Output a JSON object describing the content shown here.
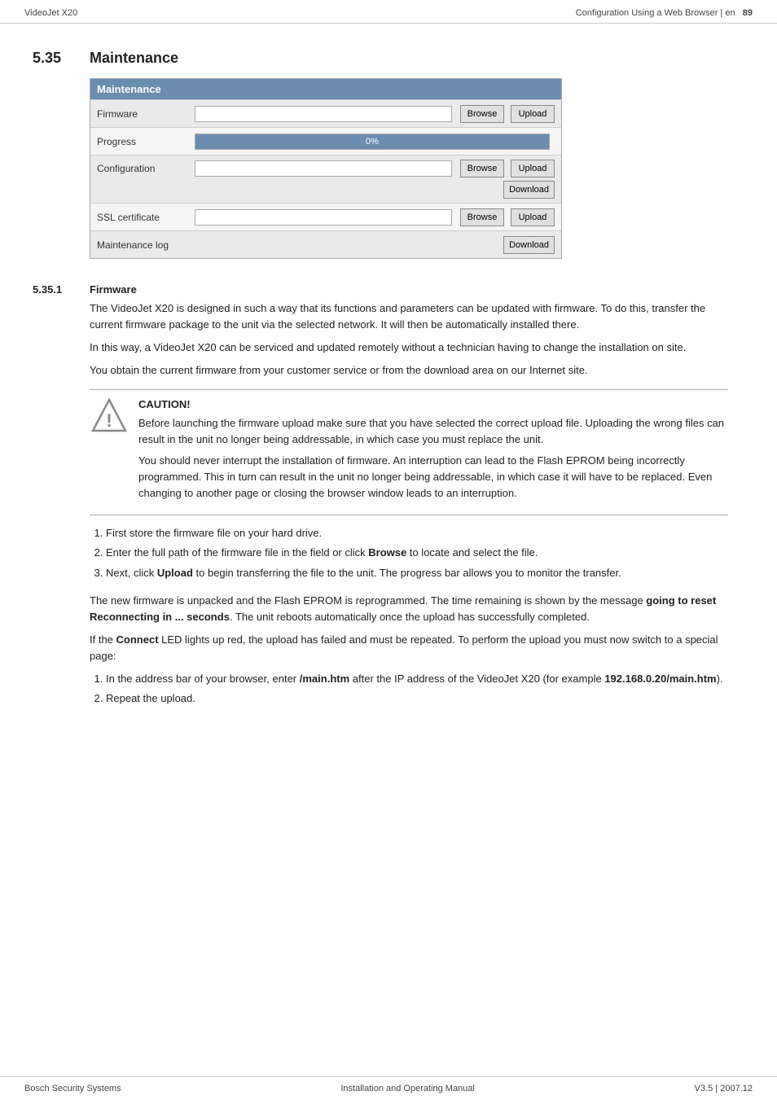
{
  "header": {
    "left": "VideoJet X20",
    "right_text": "Configuration Using a Web Browser | en",
    "page_number": "89"
  },
  "section": {
    "number": "5.35",
    "title": "Maintenance"
  },
  "maintenance_panel": {
    "header": "Maintenance",
    "rows": [
      {
        "label": "Firmware",
        "has_input": true,
        "input_value": "",
        "has_browse": true,
        "browse_label": "Browse",
        "has_upload": true,
        "upload_label": "Upload",
        "has_download": false,
        "download_label": ""
      },
      {
        "label": "Progress",
        "has_input": true,
        "input_value": "0%",
        "is_progress": true,
        "has_browse": false,
        "has_upload": false,
        "has_download": false
      },
      {
        "label": "Configuration",
        "has_input": true,
        "input_value": "",
        "has_browse": true,
        "browse_label": "Browse",
        "has_upload": true,
        "upload_label": "Upload",
        "has_download": true,
        "download_label": "Download"
      },
      {
        "label": "SSL certificate",
        "has_input": true,
        "input_value": "",
        "has_browse": true,
        "browse_label": "Browse",
        "has_upload": true,
        "upload_label": "Upload",
        "has_download": false,
        "download_label": ""
      },
      {
        "label": "Maintenance log",
        "has_input": false,
        "has_browse": false,
        "has_upload": false,
        "has_download": true,
        "download_label": "Download"
      }
    ]
  },
  "subsection": {
    "number": "5.35.1",
    "title": "Firmware"
  },
  "firmware_paragraphs": [
    "The VideoJet X20 is designed in such a way that its functions and parameters can be updated with firmware. To do this, transfer the current firmware package to the unit via the selected network. It will then be automatically installed there.",
    "In this way, a VideoJet X20 can be serviced and updated remotely without a technician having to change the installation on site.",
    "You obtain the current firmware from your customer service or from the download area on our Internet site."
  ],
  "caution": {
    "title": "CAUTION!",
    "paragraphs": [
      "Before launching the firmware upload make sure that you have selected the correct upload file. Uploading the wrong files can result in the unit no longer being addressable, in which case you must replace the unit.",
      "You should never interrupt the installation of firmware. An interruption can lead to the Flash EPROM being incorrectly programmed. This in turn can result in the unit no longer being addressable, in which case it will have to be replaced. Even changing to another page or closing the browser window leads to an interruption."
    ]
  },
  "steps": [
    "First store the firmware file on your hard drive.",
    "Enter the full path of the firmware file in the field or click <b>Browse</b> to locate and select the file.",
    "Next, click <b>Upload</b> to begin transferring the file to the unit. The progress bar allows you to monitor the transfer."
  ],
  "post_steps_paragraphs": [
    "The new firmware is unpacked and the Flash EPROM is reprogrammed. The time remaining is shown by the message <b>going to reset Reconnecting in ... seconds</b>. The unit reboots automatically once the upload has successfully completed.",
    "If the <b>Connect</b> LED lights up red, the upload has failed and must be repeated. To perform the upload you must now switch to a special page:"
  ],
  "final_steps": [
    "In the address bar of your browser, enter <b>/main.htm</b> after the IP address of the VideoJet X20 (for example <b>192.168.0.20/main.htm</b>).",
    "Repeat the upload."
  ],
  "footer": {
    "left": "Bosch Security Systems",
    "center": "Installation and Operating Manual",
    "right": "V3.5 | 2007.12"
  }
}
